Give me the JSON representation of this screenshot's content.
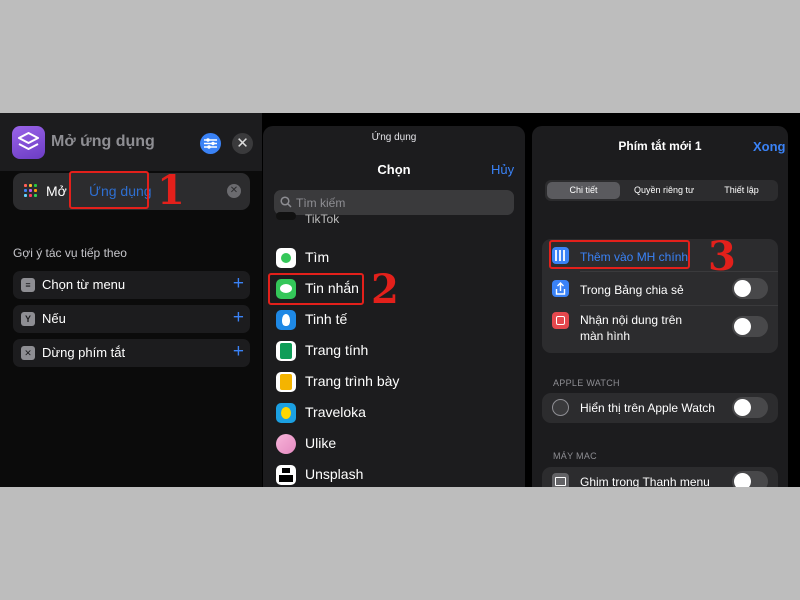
{
  "panel1": {
    "title": "Mở ứng dụng",
    "action_verb": "Mở",
    "action_param": "Ứng dụng",
    "step_number": "1",
    "suggestions_title": "Gợi ý tác vụ tiếp theo",
    "suggestions": [
      {
        "label": "Chọn từ menu",
        "icon": "menu-list-icon"
      },
      {
        "label": "Nếu",
        "icon": "branch-icon"
      },
      {
        "label": "Dừng phím tắt",
        "icon": "stop-icon"
      }
    ],
    "plus": "+",
    "close": "✕"
  },
  "panel2": {
    "top_label": "Ứng dụng",
    "title": "Chọn",
    "cancel": "Hủy",
    "search_placeholder": "Tìm kiếm",
    "step_number": "2",
    "apps": [
      {
        "label": "TikTok",
        "icon": "tiktok-icon"
      },
      {
        "label": "Tìm",
        "icon": "find-my-icon"
      },
      {
        "label": "Tin nhắn",
        "icon": "messages-icon"
      },
      {
        "label": "Tinh tế",
        "icon": "tinhte-icon"
      },
      {
        "label": "Trang tính",
        "icon": "sheets-icon"
      },
      {
        "label": "Trang trình bày",
        "icon": "slides-icon"
      },
      {
        "label": "Traveloka",
        "icon": "traveloka-icon"
      },
      {
        "label": "Ulike",
        "icon": "ulike-icon"
      },
      {
        "label": "Unsplash",
        "icon": "unsplash-icon"
      }
    ]
  },
  "panel3": {
    "title": "Phím tắt mới 1",
    "done": "Xong",
    "tabs": [
      "Chi tiết",
      "Quyền riêng tư",
      "Thiết lập"
    ],
    "active_tab": "Chi tiết",
    "step_number": "3",
    "options": [
      {
        "label": "Thêm vào MH chính",
        "icon": "home-screen-icon"
      },
      {
        "label": "Trong Bảng chia sẻ",
        "icon": "share-icon"
      },
      {
        "label": "Nhận nội dung trên màn hình",
        "icon": "screen-capture-icon"
      }
    ],
    "section_watch": "APPLE WATCH",
    "watch_option": "Hiển thị trên Apple Watch",
    "section_mac": "MÁY MAC",
    "mac_option": "Ghim trong Thanh menu"
  },
  "colors": {
    "accent": "#3a82f6",
    "highlight": "#e3201b",
    "panel_bg": "#1c1c1e",
    "card_bg": "#2c2c2e"
  }
}
